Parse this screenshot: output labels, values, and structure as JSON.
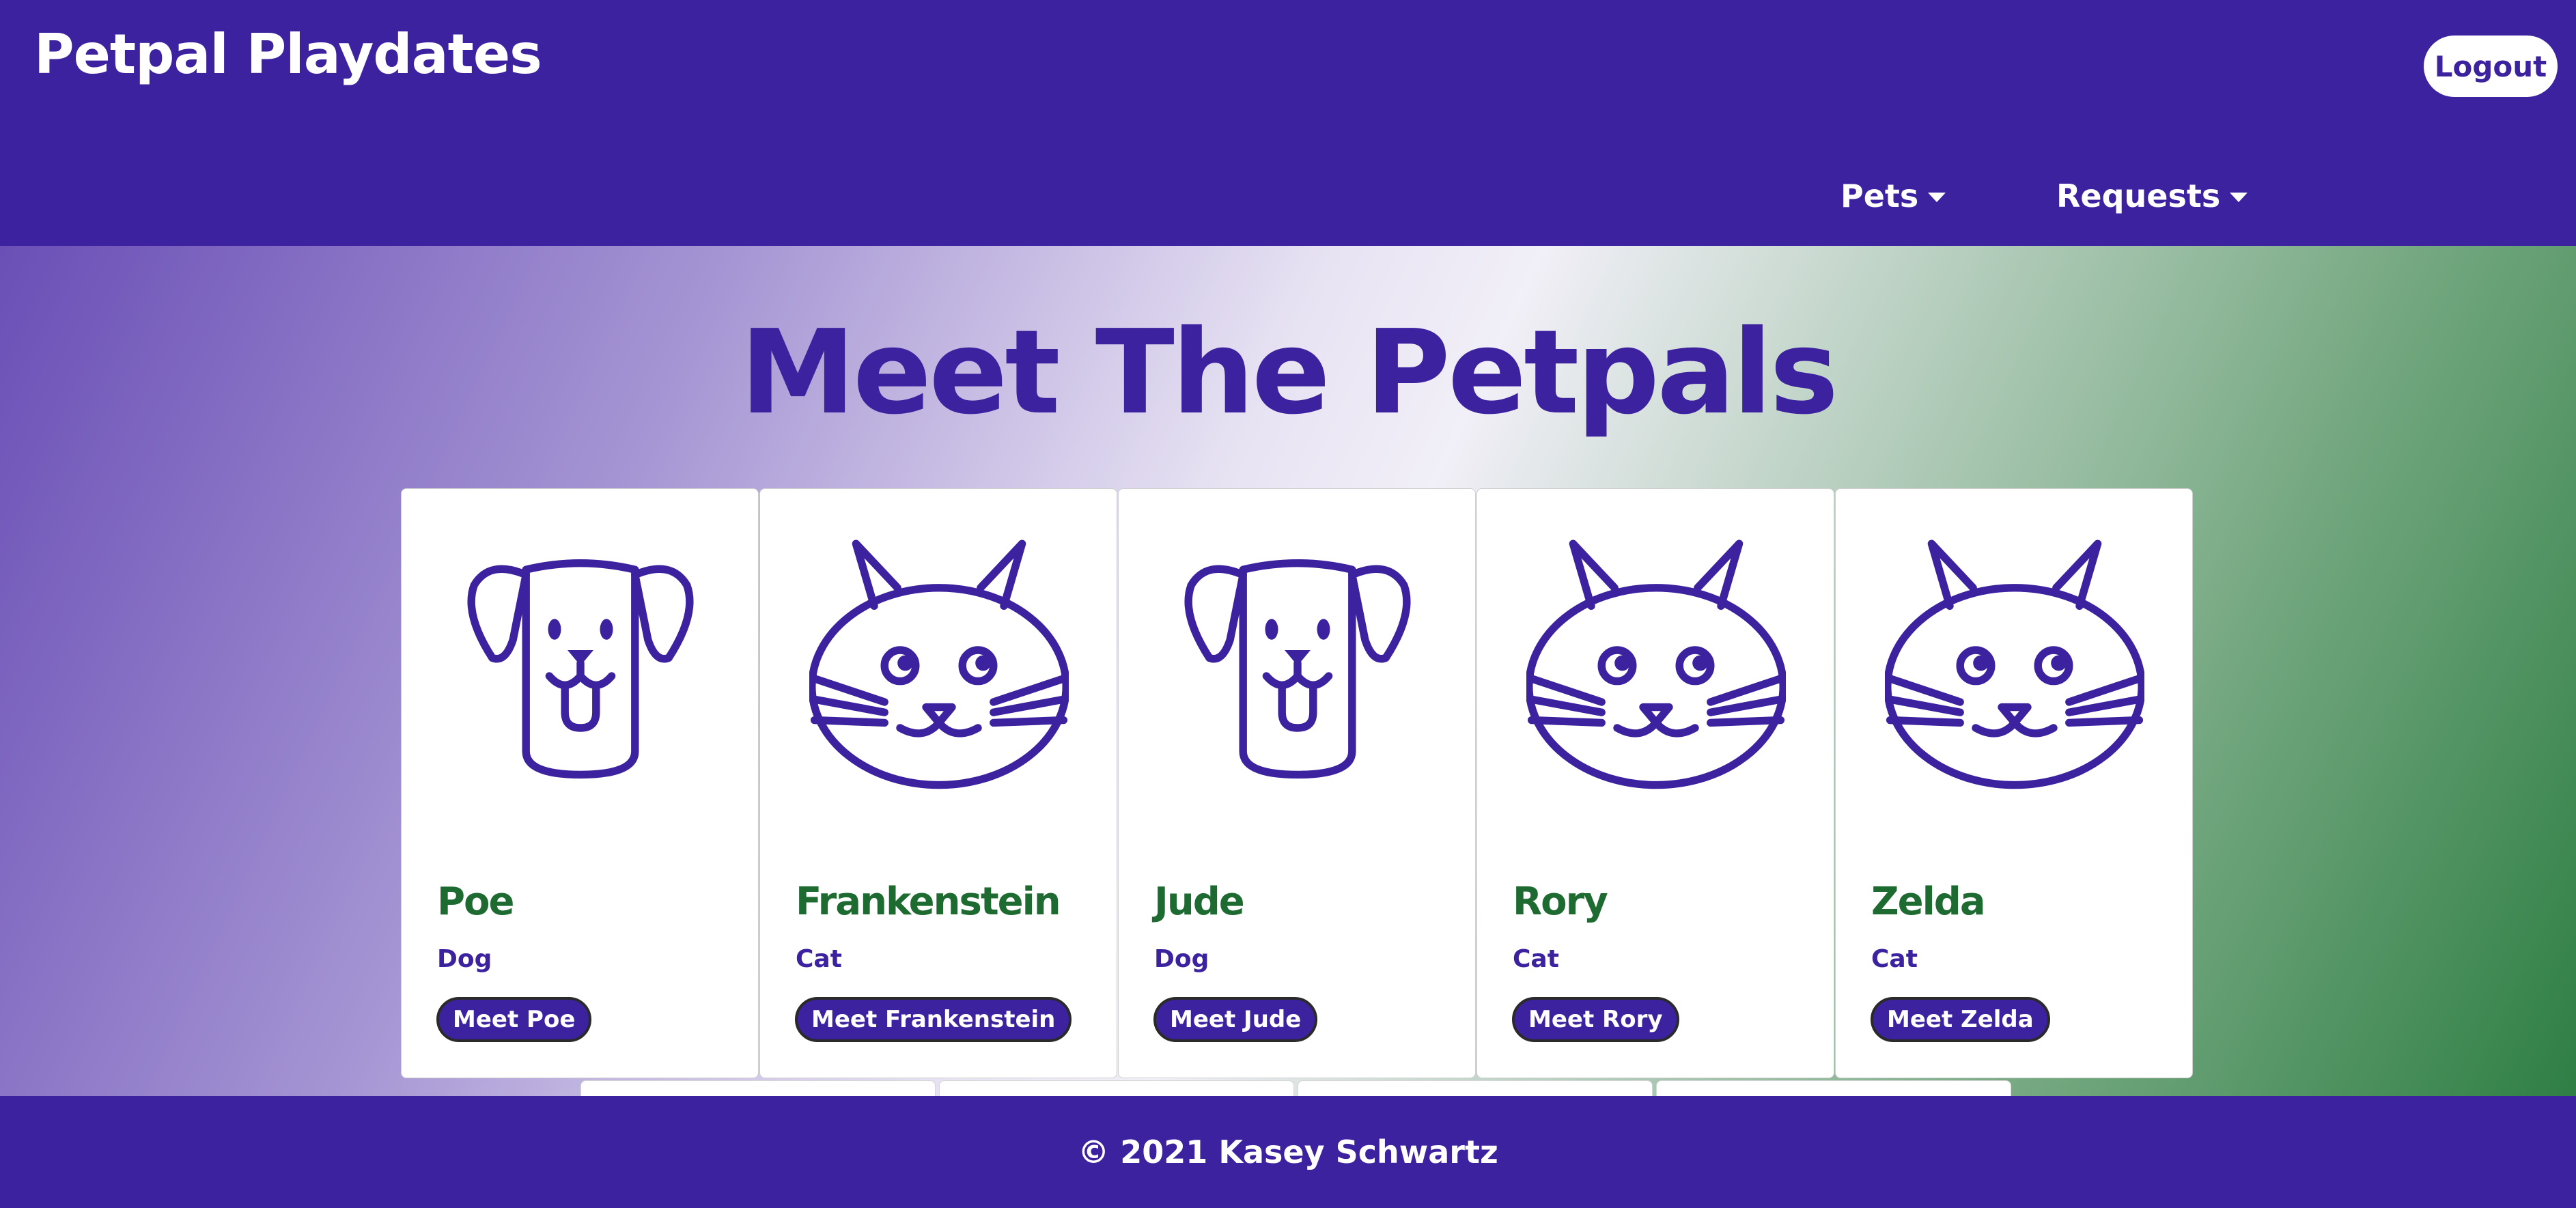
{
  "header": {
    "brand": "Petpal Playdates",
    "logout_label": "Logout",
    "nav": [
      {
        "label": "Pets"
      },
      {
        "label": "Requests"
      }
    ]
  },
  "main": {
    "title": "Meet The Petpals",
    "pets": [
      {
        "name": "Poe",
        "type": "Dog",
        "button": "Meet Poe",
        "icon": "dog-icon"
      },
      {
        "name": "Frankenstein",
        "type": "Cat",
        "button": "Meet Frankenstein",
        "icon": "cat-icon"
      },
      {
        "name": "Jude",
        "type": "Dog",
        "button": "Meet Jude",
        "icon": "dog-icon"
      },
      {
        "name": "Rory",
        "type": "Cat",
        "button": "Meet Rory",
        "icon": "cat-icon"
      },
      {
        "name": "Zelda",
        "type": "Cat",
        "button": "Meet Zelda",
        "icon": "cat-icon"
      }
    ]
  },
  "footer": {
    "copyright": "© 2021 Kasey Schwartz"
  },
  "colors": {
    "primary": "#3d22a0",
    "pet_name": "#1e6b31",
    "white": "#ffffff"
  }
}
